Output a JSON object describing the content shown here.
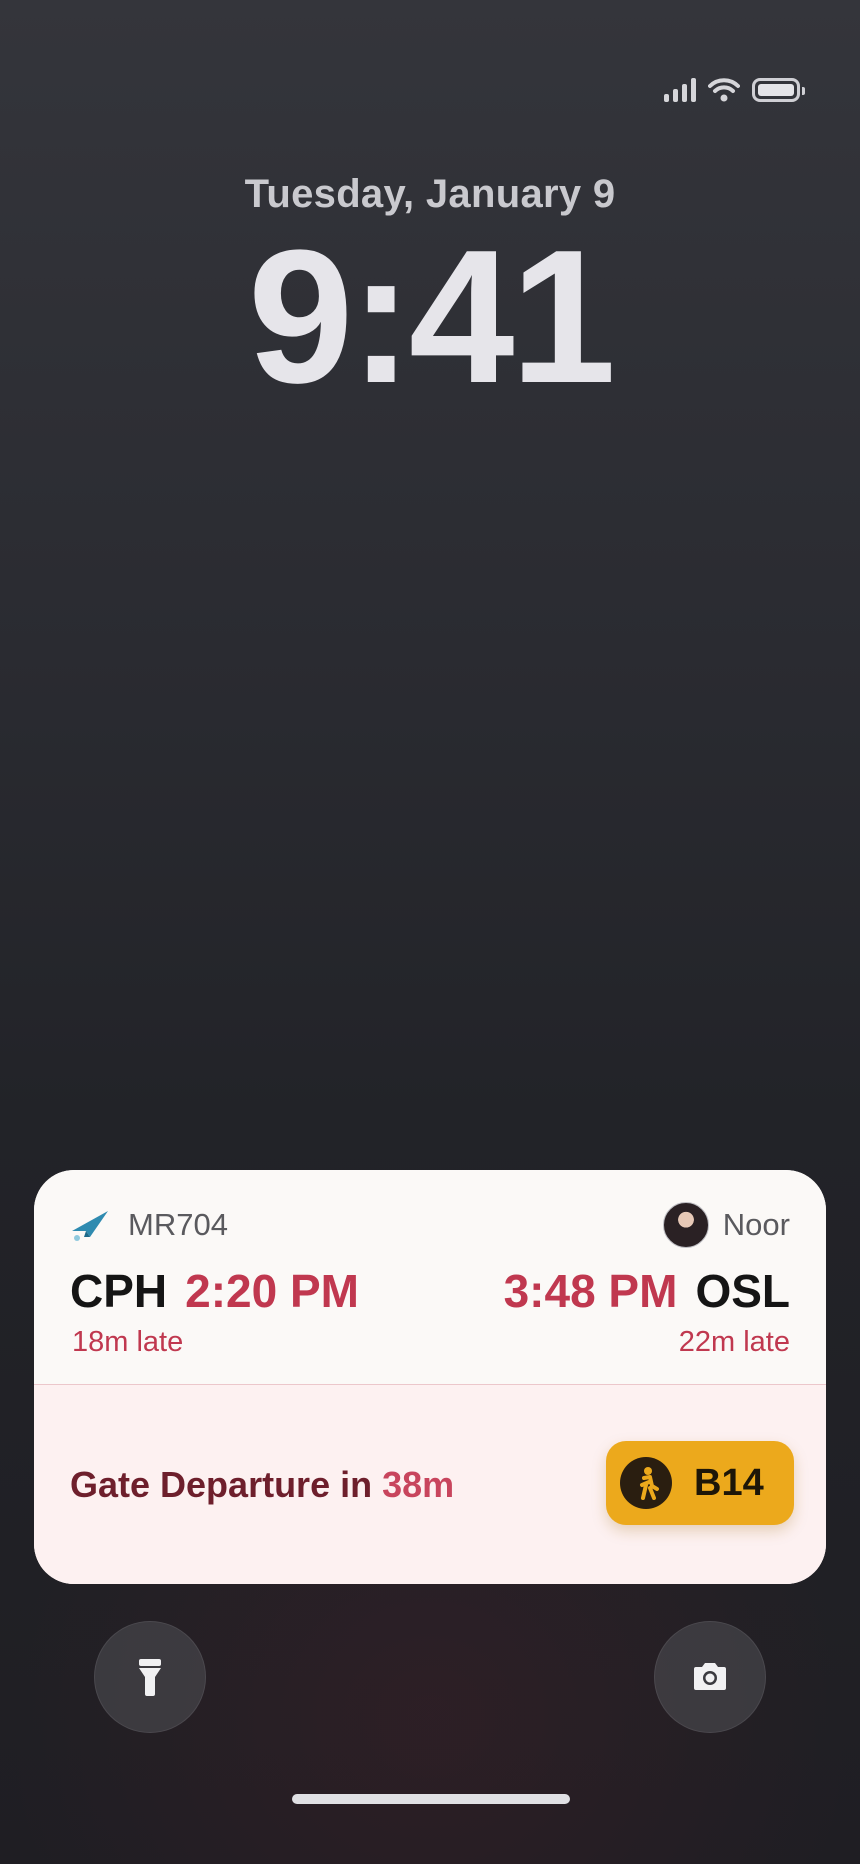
{
  "status_bar": {
    "signal_icon": "cellular-signal-icon",
    "wifi_icon": "wifi-icon",
    "battery_icon": "battery-icon",
    "battery_level": 1.0
  },
  "lock_screen": {
    "date": "Tuesday, January 9",
    "time": "9:41"
  },
  "live_activity": {
    "airline_icon": "paper-plane-icon",
    "flight_number": "MR704",
    "traveler_name": "Noor",
    "origin": {
      "code": "CPH",
      "time": "2:20 PM",
      "delay": "18m late"
    },
    "destination": {
      "code": "OSL",
      "time": "3:48 PM",
      "delay": "22m late"
    },
    "gate_departure": {
      "label": "Gate Departure in",
      "countdown": "38m"
    },
    "gate": {
      "icon": "walking-person-icon",
      "code": "B14"
    },
    "colors": {
      "accent_red": "#c0384f",
      "gate_badge": "#eca91c",
      "card_bottom": "#fdf1f1"
    }
  },
  "controls": {
    "flashlight_icon": "flashlight-icon",
    "camera_icon": "camera-icon"
  }
}
